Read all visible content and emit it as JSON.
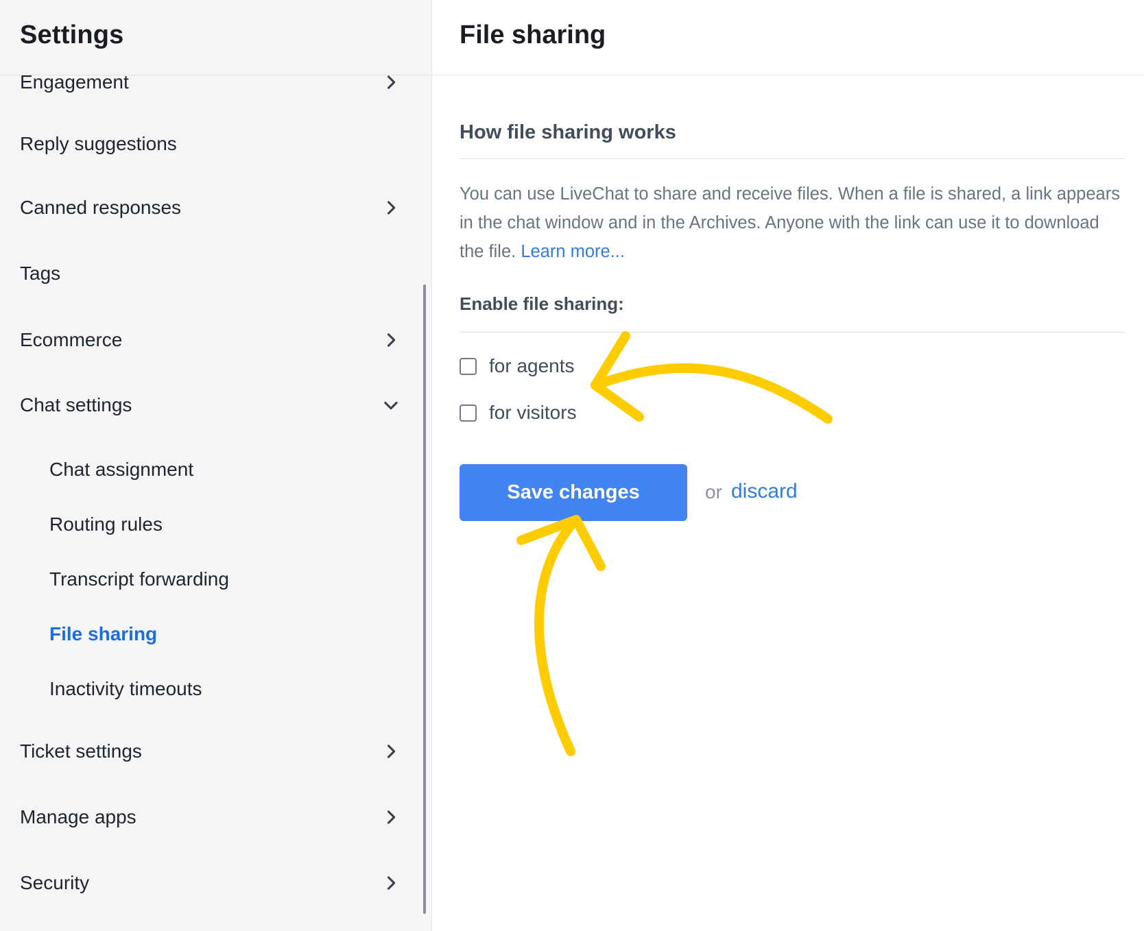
{
  "sidebar": {
    "title": "Settings",
    "items": [
      {
        "label": "Engagement",
        "chevron": "chevron-right"
      },
      {
        "label": "Reply suggestions",
        "chevron": null
      },
      {
        "label": "Canned responses",
        "chevron": "chevron-right"
      },
      {
        "label": "Tags",
        "chevron": null
      },
      {
        "label": "Ecommerce",
        "chevron": "chevron-right"
      },
      {
        "label": "Chat settings",
        "chevron": "chevron-down",
        "expanded": true
      },
      {
        "label": "Chat assignment",
        "sub": true
      },
      {
        "label": "Routing rules",
        "sub": true
      },
      {
        "label": "Transcript forwarding",
        "sub": true
      },
      {
        "label": "File sharing",
        "sub": true,
        "active": true
      },
      {
        "label": "Inactivity timeouts",
        "sub": true
      },
      {
        "label": "Ticket settings",
        "chevron": "chevron-right"
      },
      {
        "label": "Manage apps",
        "chevron": "chevron-right"
      },
      {
        "label": "Security",
        "chevron": "chevron-right"
      }
    ]
  },
  "main": {
    "title": "File sharing",
    "section_title": "How file sharing works",
    "description": "You can use LiveChat to share and receive files. When a file is shared, a link appears in the chat window and in the Archives. Anyone with the link can use it to download the file.",
    "learn_more": "Learn more...",
    "enable_label": "Enable file sharing:",
    "checkboxes": [
      {
        "label": "for agents",
        "checked": false
      },
      {
        "label": "for visitors",
        "checked": false
      }
    ],
    "save_label": "Save changes",
    "or_text": "or",
    "discard_label": "discard"
  },
  "colors": {
    "accent": "#4284f2",
    "link": "#2f7de1",
    "active_nav": "#1a6fe0",
    "annotation_arrow": "#ffcc00",
    "sidebar_bg": "#f5f5f5"
  }
}
